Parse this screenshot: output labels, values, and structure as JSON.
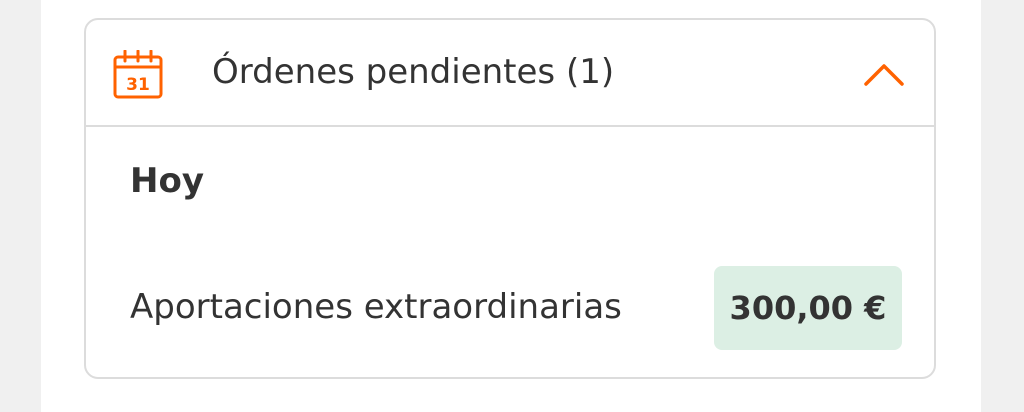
{
  "pending_orders": {
    "title": "Órdenes pendientes (1)",
    "icon": "calendar-icon",
    "icon_day": "31",
    "expanded_icon": "chevron-up-icon",
    "groups": [
      {
        "day_label": "Hoy",
        "orders": [
          {
            "label": "Aportaciones extraordinarias",
            "amount": "300,00 €"
          }
        ]
      }
    ]
  },
  "colors": {
    "accent": "#ff6200",
    "text": "#333333",
    "border": "#dcdcdc",
    "amount_badge_bg": "#dcefe4",
    "page_bg": "#f0f0f0"
  }
}
